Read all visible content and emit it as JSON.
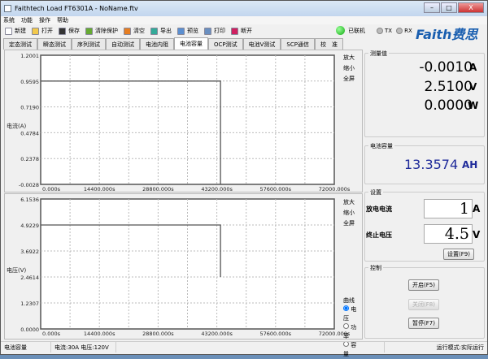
{
  "window": {
    "title": "Faithtech Load FT6301A - NoName.ftv",
    "min": "–",
    "max": "□",
    "close": "X"
  },
  "menu": [
    "系统",
    "功能",
    "操作",
    "帮助"
  ],
  "toolbar": [
    {
      "label": "新建",
      "icon": "new-file-icon",
      "color": "#ffffff"
    },
    {
      "label": "打开",
      "icon": "folder-open-icon",
      "color": "#f2c94c"
    },
    {
      "label": "保存",
      "icon": "save-icon",
      "color": "#333333"
    },
    {
      "label": "清除保护",
      "icon": "clear-protect-icon",
      "color": "#6a3"
    },
    {
      "label": "清空",
      "icon": "clear-icon",
      "color": "#e67e22"
    },
    {
      "label": "导出",
      "icon": "export-icon",
      "color": "#3a9"
    },
    {
      "label": "预览",
      "icon": "preview-icon",
      "color": "#5b8fd0"
    },
    {
      "label": "打印",
      "icon": "print-icon",
      "color": "#6a8fc0"
    },
    {
      "label": "断开",
      "icon": "disconnect-icon",
      "color": "#d02060"
    }
  ],
  "connection": {
    "label": "已联机",
    "color": "#22bb22",
    "tx": "TX",
    "rx": "RX"
  },
  "logo": "Faith费思",
  "tabs": [
    "定态测试",
    "瞬态测试",
    "序列测试",
    "自动测试",
    "电池内阻",
    "电池容量",
    "OCP测试",
    "电池V测试",
    "SCP通信",
    "校　准"
  ],
  "active_tab": 5,
  "side_buttons": {
    "zoom_in": "放大",
    "zoom_out": "缩小",
    "fullscreen": "全屏"
  },
  "curve": {
    "title": "曲线",
    "options": [
      "电压",
      "功率",
      "容量"
    ],
    "selected": 0
  },
  "measure": {
    "title": "测量值",
    "current": "-0.0010",
    "current_unit": "A",
    "voltage": "2.5100",
    "voltage_unit": "V",
    "power": "0.0000",
    "power_unit": "W"
  },
  "capacity": {
    "title": "电池容量",
    "value": "13.3574",
    "unit": "AH"
  },
  "settings": {
    "title": "设置",
    "discharge_label": "放电电流",
    "discharge_value": "1",
    "discharge_unit": "A",
    "cutoff_label": "终止电压",
    "cutoff_value": "4.5",
    "cutoff_unit": "V",
    "set_button": "设置(F9)"
  },
  "control": {
    "title": "控制",
    "start": "开启(F5)",
    "stop": "关闭(F8)",
    "pause": "暂停(F7)"
  },
  "status": {
    "mode": "电池容量",
    "range": "电流:30A  电压:120V",
    "run": "运行模式:实际运行"
  },
  "chart_data": [
    {
      "type": "line",
      "ylabel": "电流(A)",
      "ylim": [
        -0.0028,
        1.2001
      ],
      "yticks": [
        "1.2001",
        "0.9595",
        "0.7190",
        "0.4784",
        "0.2378",
        "-0.0028"
      ],
      "xlim": [
        0,
        72000
      ],
      "xticks": [
        0,
        14400,
        28800,
        43200,
        57600,
        72000
      ],
      "xtick_labels": [
        "0.000s",
        "14400.000s",
        "28800.000s",
        "43200.000s",
        "57600.000s",
        "72000.000s"
      ],
      "grid": true,
      "series": [
        {
          "name": "电流",
          "x": [
            0,
            44100,
            44100
          ],
          "y": [
            0.9595,
            0.9595,
            -0.0028
          ]
        }
      ]
    },
    {
      "type": "line",
      "ylabel": "电压(V)",
      "ylim": [
        0,
        6.1536
      ],
      "yticks": [
        "6.1536",
        "4.9229",
        "3.6922",
        "2.4614",
        "1.2307",
        "0.0000"
      ],
      "xlim": [
        0,
        72000
      ],
      "xticks": [
        0,
        14400,
        28800,
        43200,
        57600,
        72000
      ],
      "xtick_labels": [
        "0.000s",
        "14400.000s",
        "28800.000s",
        "43200.000s",
        "57600.000s",
        "72000.000s"
      ],
      "grid": true,
      "series": [
        {
          "name": "电压",
          "x": [
            0,
            44100,
            44100
          ],
          "y": [
            4.9229,
            4.9229,
            2.4614
          ]
        }
      ]
    }
  ]
}
